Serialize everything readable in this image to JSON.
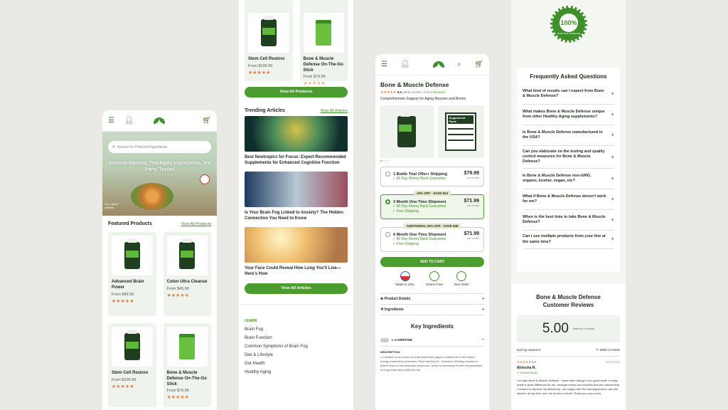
{
  "panel1": {
    "search_placeholder": "Search for Products/Ingredients",
    "hero_title": "Science-Backed, Traceable Ingredients, 3rd Party Tested",
    "hero_badge": "Our Latest Articles",
    "featured_title": "Featured Products",
    "view_all": "View All Products",
    "products": [
      {
        "name": "Advanced Brain Power",
        "price": "From $49.99",
        "stars": "★★★★★",
        "kind": "bottle"
      },
      {
        "name": "Colon Ultra Cleanse",
        "price": "From $49.99",
        "stars": "★★★★★",
        "kind": "bottle"
      },
      {
        "name": "Stem Cell Restore",
        "price": "From $109.99",
        "stars": "★★★★★",
        "kind": "bottle"
      },
      {
        "name": "Bone & Muscle Defense On-The-Go Stick",
        "price": "From $79.99",
        "stars": "★★★★★",
        "kind": "bag"
      }
    ]
  },
  "panel2": {
    "products": [
      {
        "name": "Stem Cell Restore",
        "price": "From $109.99",
        "stars": "★★★★★"
      },
      {
        "name": "Bone & Muscle Defense On-The-Go Stick",
        "price": "From $79.99",
        "stars": "★★★★★"
      }
    ],
    "view_all_products": "View All Products",
    "trending_title": "Trending Articles",
    "view_all_articles_link": "View All Articles",
    "articles": [
      {
        "title": "Best Nootropics for Focus: Expert-Recommended Supplements for Enhanced Cognitive Function"
      },
      {
        "title": "Is Your Brain Fog Linked to Anxiety? The Hidden Connection You Need to Know"
      },
      {
        "title": "Your Face Could Reveal How Long You'll Live—Here's How"
      }
    ],
    "view_all_articles": "View All Articles",
    "learn_title": "LEARN",
    "learn_links": [
      "Brain Fog",
      "Brain Function",
      "Common Symptoms of Brain Fog",
      "Diet & Lifestyle",
      "Gut Health",
      "Healthy Aging"
    ]
  },
  "panel3": {
    "title": "Bone & Muscle Defense",
    "rating": "5.0",
    "sold": "28650 Bottles Sold",
    "reviews_link": "4 Reviews",
    "subtitle": "Comprehensive Support for Aging Muscles and Bones",
    "supplement_facts": "Supplement Facts",
    "options": [
      {
        "label": "1 Bottle Trial Offer+ Shipping",
        "price": "$79.99",
        "unit": "per bottle",
        "tag": "",
        "checks": [
          "90 Day Money Back Guarantee"
        ],
        "selected": false
      },
      {
        "label": "3 Month One-Time Shipment",
        "price": "$71.99",
        "unit": "per bottle",
        "tag": "10% OFF - SAVE $24",
        "checks": [
          "90 Day Money Back Guarantee",
          "Free Shipping"
        ],
        "selected": true
      },
      {
        "label": "6 Month One-Time Shipment",
        "price": "$71.99",
        "unit": "per bottle",
        "tag": "ADDITIONAL 10% OFF - SAVE $48",
        "checks": [
          "90 Day Money Back Guarantee",
          "Free Shipping"
        ],
        "selected": false
      }
    ],
    "add_to_cart": "ADD TO CART",
    "badges": [
      "Made in USA",
      "Gluten-Free",
      "Non-GMO"
    ],
    "product_details": "Product Details",
    "ingredients": "Ingredients",
    "key_ingredients": "Key Ingredients",
    "ingredient_name": "L-CARNITINE",
    "description_label": "DESCRIPTION",
    "description": "L-Carnitine is an amino acid derivative that plays a critical role in the body's energy production processes. Each serving of L-Carnitine 1000mg provides a potent dose of this essential compound, which is necessary for the transportation of long-chain fatty acids into the"
  },
  "panel4": {
    "seal_text": "100%",
    "seal_sub": "MONEY BACK GUARANTEE",
    "faq_title": "Frequently Asked Questions",
    "faqs": [
      "What kind of results can I expect from Bone & Muscle Defense?",
      "What makes Bone & Muscle Defense unique from other Healthy-Aging supplements?",
      "Is Bone & Muscle Defense manufactured in the USA?",
      "Can you elaborate on the testing and quality control measures for Bone & Muscle Defense?",
      "Is Bone & Muscle Defense non-GMO, organic, kosher, vegan, etc?",
      "What if Bone & Muscle Defense doesn't work for me?",
      "When is the best time to take Bone & Muscle Defense?",
      "Can I use multiple products from your line at the same time?"
    ],
    "reviews_title": "Bone & Muscle Defense Customer Reviews",
    "score": "5.00",
    "based_on": "based on 4 reviews",
    "sort": "Sort by newest",
    "write_review": "Write a review",
    "review_stars": "★★★★★",
    "review_rating": "5.0",
    "review_date": "10/01/2024",
    "reviewer": "Wolesha R.",
    "verified": "Verified Buyer",
    "review_text": "I do take Bone & Muscle Defense. I have been taking it for a good while. It really made a good difference for me, stronger bones and muscles and the calcium that I needed to improve my deficiency. I am happy with the fast supplement, and the service, at any time over the phone or email. Thank you very much."
  }
}
